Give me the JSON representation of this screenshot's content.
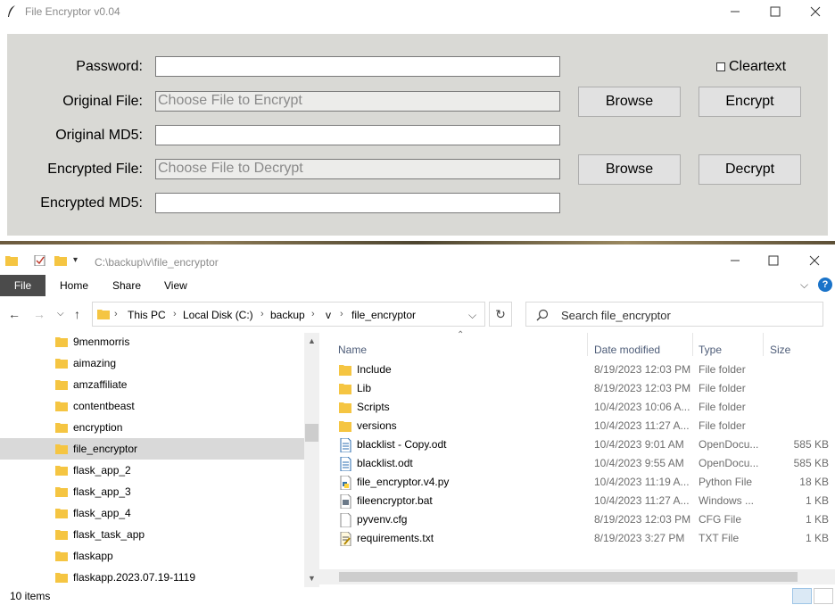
{
  "tk_window": {
    "title": "File Encryptor v0.04",
    "fields": {
      "password_label": "Password:",
      "original_file_label": "Original File:",
      "original_file_placeholder": "Choose File to Encrypt",
      "original_md5_label": "Original MD5:",
      "encrypted_file_label": "Encrypted File:",
      "encrypted_file_placeholder": "Choose File to Decrypt",
      "encrypted_md5_label": "Encrypted MD5:"
    },
    "cleartext_label": "Cleartext",
    "buttons": {
      "browse_original": "Browse",
      "encrypt": "Encrypt",
      "browse_encrypted": "Browse",
      "decrypt": "Decrypt"
    }
  },
  "explorer": {
    "title_path": "C:\\backup\\v\\file_encryptor",
    "ribbon_tabs": [
      "File",
      "Home",
      "Share",
      "View"
    ],
    "breadcrumb": [
      "This PC",
      "Local Disk (C:)",
      "backup",
      "v",
      "file_encryptor"
    ],
    "search_placeholder": "Search file_encryptor",
    "nav_items": [
      {
        "label": "9menmorris",
        "selected": false
      },
      {
        "label": "aimazing",
        "selected": false
      },
      {
        "label": "amzaffiliate",
        "selected": false
      },
      {
        "label": "contentbeast",
        "selected": false
      },
      {
        "label": "encryption",
        "selected": false
      },
      {
        "label": "file_encryptor",
        "selected": true
      },
      {
        "label": "flask_app_2",
        "selected": false
      },
      {
        "label": "flask_app_3",
        "selected": false
      },
      {
        "label": "flask_app_4",
        "selected": false
      },
      {
        "label": "flask_task_app",
        "selected": false
      },
      {
        "label": "flaskapp",
        "selected": false
      },
      {
        "label": "flaskapp.2023.07.19-1119",
        "selected": false
      }
    ],
    "columns": {
      "name": "Name",
      "date": "Date modified",
      "type": "Type",
      "size": "Size"
    },
    "files": [
      {
        "name": "Include",
        "date": "8/19/2023 12:03 PM",
        "type": "File folder",
        "size": "",
        "icon": "folder-icon"
      },
      {
        "name": "Lib",
        "date": "8/19/2023 12:03 PM",
        "type": "File folder",
        "size": "",
        "icon": "folder-icon"
      },
      {
        "name": "Scripts",
        "date": "10/4/2023 10:06 A...",
        "type": "File folder",
        "size": "",
        "icon": "folder-icon"
      },
      {
        "name": "versions",
        "date": "10/4/2023 11:27 A...",
        "type": "File folder",
        "size": "",
        "icon": "folder-icon"
      },
      {
        "name": "blacklist - Copy.odt",
        "date": "10/4/2023 9:01 AM",
        "type": "OpenDocu...",
        "size": "585 KB",
        "icon": "document-icon"
      },
      {
        "name": "blacklist.odt",
        "date": "10/4/2023 9:55 AM",
        "type": "OpenDocu...",
        "size": "585 KB",
        "icon": "document-icon"
      },
      {
        "name": "file_encryptor.v4.py",
        "date": "10/4/2023 11:19 A...",
        "type": "Python File",
        "size": "18 KB",
        "icon": "python-file-icon"
      },
      {
        "name": "fileencryptor.bat",
        "date": "10/4/2023 11:27 A...",
        "type": "Windows ...",
        "size": "1 KB",
        "icon": "batch-file-icon"
      },
      {
        "name": "pyvenv.cfg",
        "date": "8/19/2023 12:03 PM",
        "type": "CFG File",
        "size": "1 KB",
        "icon": "blank-file-icon"
      },
      {
        "name": "requirements.txt",
        "date": "8/19/2023 3:27 PM",
        "type": "TXT File",
        "size": "1 KB",
        "icon": "text-file-icon"
      }
    ],
    "status_count": "10 items"
  }
}
